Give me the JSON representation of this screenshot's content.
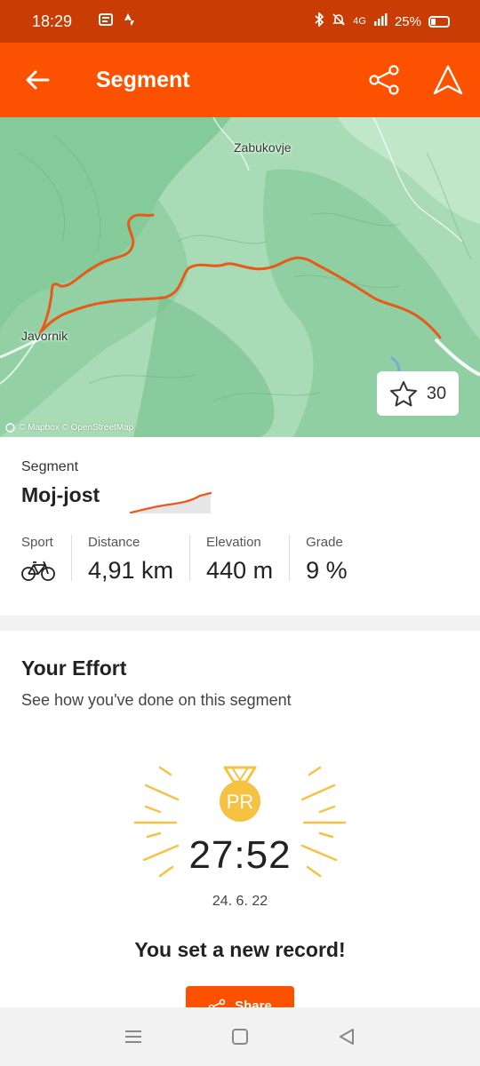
{
  "status": {
    "time": "18:29",
    "network": "4G",
    "battery": "25%",
    "icons": [
      "notes-icon",
      "strava-icon",
      "bluetooth-icon",
      "mute-icon",
      "signal-icon",
      "battery-icon"
    ]
  },
  "appbar": {
    "title": "Segment",
    "icons": [
      "back-arrow-icon",
      "share-icon",
      "navigate-icon"
    ],
    "background": "#fc5200"
  },
  "map": {
    "places": [
      "Zabukovje",
      "Javornik"
    ],
    "star_count": "30",
    "attribution": "© Mapbox © OpenStreetMap",
    "route_color": "#e85a1a"
  },
  "segment": {
    "label": "Segment",
    "name": "Moj-jost",
    "stats": [
      {
        "label": "Sport",
        "icon": "bicycle-icon"
      },
      {
        "label": "Distance",
        "value": "4,91 km"
      },
      {
        "label": "Elevation",
        "value": "440 m"
      },
      {
        "label": "Grade",
        "value": "9 %"
      }
    ]
  },
  "effort": {
    "title": "Your Effort",
    "subtitle": "See how you've done on this segment",
    "badge": "PR",
    "time": "27:52",
    "date": "24. 6. 22",
    "message": "You set a new record!",
    "share_label": "Share",
    "badge_color": "#f5c242"
  },
  "navbar": {
    "icons": [
      "menu-icon",
      "home-icon",
      "back-triangle-icon"
    ]
  }
}
